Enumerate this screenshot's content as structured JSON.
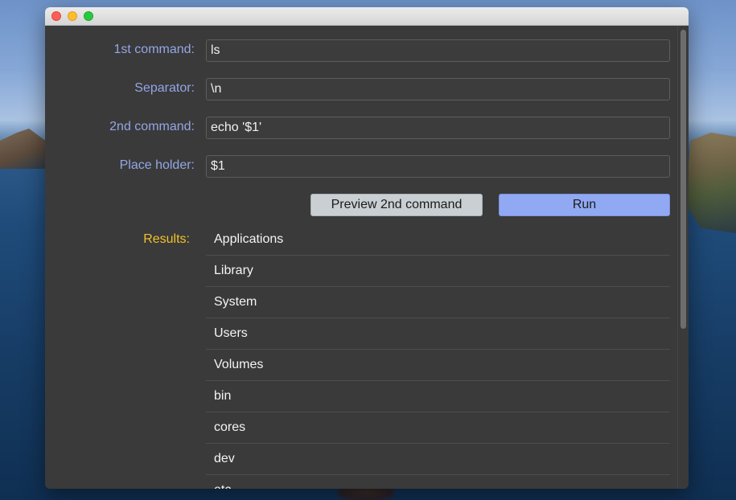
{
  "form": {
    "first_command": {
      "label": "1st command:",
      "value": "ls"
    },
    "separator": {
      "label": "Separator:",
      "value": "\\n"
    },
    "second_command": {
      "label": "2nd command:",
      "value": "echo '$1'"
    },
    "place_holder": {
      "label": "Place holder:",
      "value": "$1"
    }
  },
  "buttons": {
    "preview_label": "Preview 2nd command",
    "run_label": "Run"
  },
  "results": {
    "label": "Results:",
    "items": [
      "Applications",
      "Library",
      "System",
      "Users",
      "Volumes",
      "bin",
      "cores",
      "dev",
      "etc"
    ]
  },
  "colors": {
    "label_blue": "#94a6e6",
    "results_label_yellow": "#f2c12c",
    "run_button": "#91a9f2",
    "preview_button": "#c9cfd2",
    "window_bg": "#3a3a3a"
  }
}
